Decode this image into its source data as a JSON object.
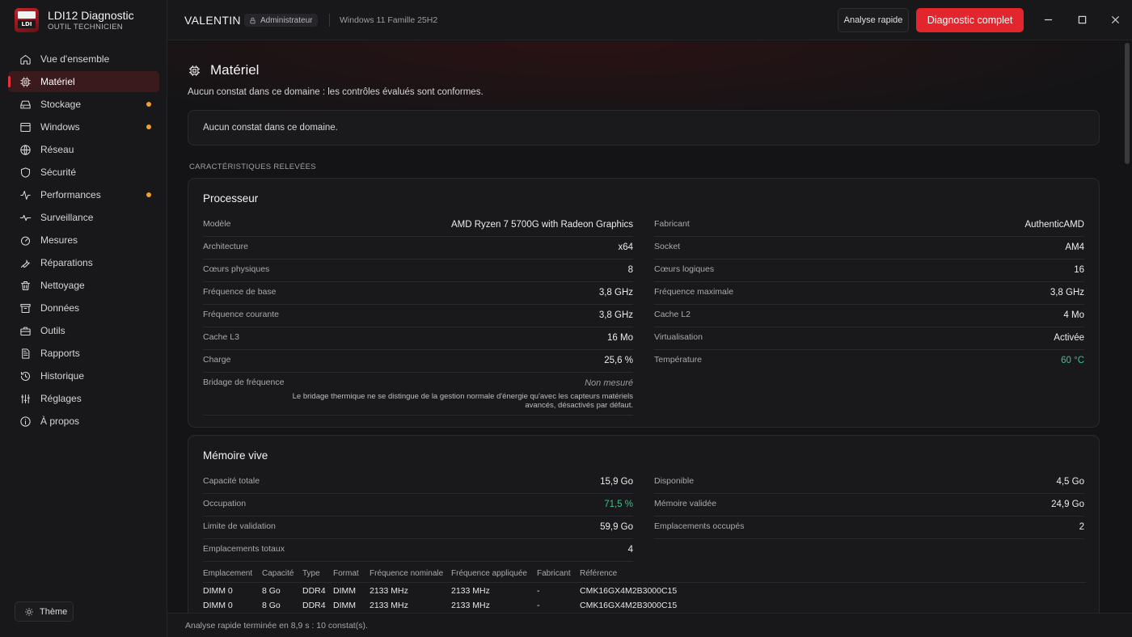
{
  "brand": {
    "title": "LDI12 Diagnostic",
    "subtitle": "OUTIL TECHNICIEN",
    "logo_text": "LDI"
  },
  "header": {
    "host": "VALENTIN",
    "role": "Administrateur",
    "os": "Windows 11 Famille 25H2",
    "quick_label": "Analyse rapide",
    "full_label": "Diagnostic complet"
  },
  "sidebar": {
    "items": [
      {
        "label": "Vue d'ensemble",
        "icon": "home-icon",
        "dot": false
      },
      {
        "label": "Matériel",
        "icon": "chip-icon",
        "dot": false,
        "active": true
      },
      {
        "label": "Stockage",
        "icon": "drive-icon",
        "dot": true
      },
      {
        "label": "Windows",
        "icon": "window-icon",
        "dot": true
      },
      {
        "label": "Réseau",
        "icon": "globe-icon",
        "dot": false
      },
      {
        "label": "Sécurité",
        "icon": "shield-icon",
        "dot": false
      },
      {
        "label": "Performances",
        "icon": "activity-icon",
        "dot": true
      },
      {
        "label": "Surveillance",
        "icon": "pulse-icon",
        "dot": false
      },
      {
        "label": "Mesures",
        "icon": "gauge-icon",
        "dot": false
      },
      {
        "label": "Réparations",
        "icon": "wrench-icon",
        "dot": false
      },
      {
        "label": "Nettoyage",
        "icon": "trash-icon",
        "dot": false
      },
      {
        "label": "Données",
        "icon": "archive-icon",
        "dot": false
      },
      {
        "label": "Outils",
        "icon": "toolbox-icon",
        "dot": false
      },
      {
        "label": "Rapports",
        "icon": "report-icon",
        "dot": false
      },
      {
        "label": "Historique",
        "icon": "history-icon",
        "dot": false
      },
      {
        "label": "Réglages",
        "icon": "sliders-icon",
        "dot": false
      },
      {
        "label": "À propos",
        "icon": "info-icon",
        "dot": false
      }
    ],
    "theme_label": "Thème"
  },
  "colors": {
    "accent": "#e3262e",
    "dot": "#f0a030",
    "ok": "#3fc08a"
  },
  "page": {
    "title": "Matériel",
    "subtitle": "Aucun constat dans ce domaine : les contrôles évalués sont conformes.",
    "notice": "Aucun constat dans ce domaine.",
    "section_label": "CARACTÉRISTIQUES RELEVÉES"
  },
  "cpu": {
    "title": "Processeur",
    "left": [
      {
        "k": "Modèle",
        "v": "AMD Ryzen 7 5700G with Radeon Graphics"
      },
      {
        "k": "Architecture",
        "v": "x64"
      },
      {
        "k": "Cœurs physiques",
        "v": "8"
      },
      {
        "k": "Fréquence de base",
        "v": "3,8 GHz"
      },
      {
        "k": "Fréquence courante",
        "v": "3,8 GHz"
      },
      {
        "k": "Cache L3",
        "v": "16 Mo"
      },
      {
        "k": "Charge",
        "v": "25,6 %"
      }
    ],
    "throttle": {
      "k": "Bridage de fréquence",
      "v": "Non mesuré",
      "note": "Le bridage thermique ne se distingue de la gestion normale d'énergie qu'avec les capteurs matériels avancés, désactivés par défaut."
    },
    "right": [
      {
        "k": "Fabricant",
        "v": "AuthenticAMD"
      },
      {
        "k": "Socket",
        "v": "AM4"
      },
      {
        "k": "Cœurs logiques",
        "v": "16"
      },
      {
        "k": "Fréquence maximale",
        "v": "3,8 GHz"
      },
      {
        "k": "Cache L2",
        "v": "4 Mo"
      },
      {
        "k": "Virtualisation",
        "v": "Activée"
      },
      {
        "k": "Température",
        "v": "60 °C"
      }
    ]
  },
  "memory": {
    "title": "Mémoire vive",
    "left": [
      {
        "k": "Capacité totale",
        "v": "15,9 Go"
      },
      {
        "k": "Occupation",
        "v": "71,5 %"
      },
      {
        "k": "Limite de validation",
        "v": "59,9 Go"
      },
      {
        "k": "Emplacements totaux",
        "v": "4"
      }
    ],
    "right": [
      {
        "k": "Disponible",
        "v": "4,5 Go"
      },
      {
        "k": "Mémoire validée",
        "v": "24,9 Go"
      },
      {
        "k": "Emplacements occupés",
        "v": "2"
      }
    ],
    "columns": [
      "Emplacement",
      "Capacité",
      "Type",
      "Format",
      "Fréquence nominale",
      "Fréquence appliquée",
      "Fabricant",
      "Référence"
    ],
    "rows": [
      [
        "DIMM 0",
        "8 Go",
        "DDR4",
        "DIMM",
        "2133 MHz",
        "2133 MHz",
        "-",
        "CMK16GX4M2B3000C15"
      ],
      [
        "DIMM 0",
        "8 Go",
        "DDR4",
        "DIMM",
        "2133 MHz",
        "2133 MHz",
        "-",
        "CMK16GX4M2B3000C15"
      ]
    ]
  },
  "status": "Analyse rapide terminée en 8,9 s : 10 constat(s)."
}
